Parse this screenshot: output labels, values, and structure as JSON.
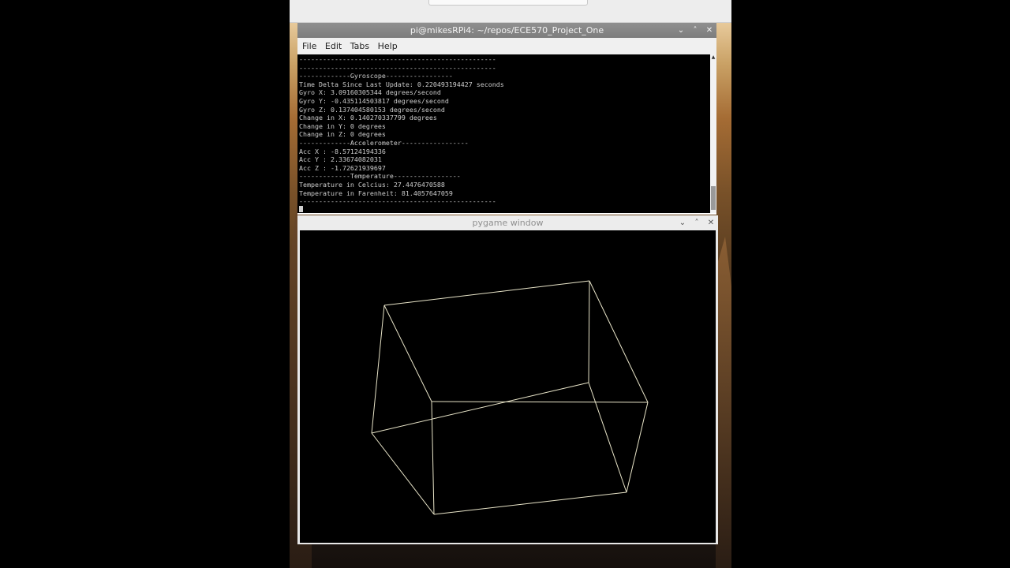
{
  "terminal": {
    "title": "pi@mikesRPi4: ~/repos/ECE570_Project_One",
    "menu": [
      "File",
      "Edit",
      "Tabs",
      "Help"
    ],
    "lines": [
      "--------------------------------------------------",
      "--------------------------------------------------",
      "-------------Gyroscope-----------------",
      "Time Delta Since Last Update: 0.220493194427 seconds",
      "Gyro X: 3.09160305344 degrees/second",
      "Gyro Y: -0.435114503817 degrees/second",
      "Gyro Z: 0.137404580153 degrees/second",
      "Change in X: 0.140270337799 degrees",
      "Change in Y: 0 degrees",
      "Change in Z: 0 degrees",
      "-------------Accelerometer-----------------",
      "Acc X : -8.57124194336",
      "Acc Y : 2.33674082031",
      "Acc Z : -1.72621939697",
      "-------------Temperature-----------------",
      "Temperature in Celcius: 27.4476470588",
      "Temperature in Farenheit: 81.4057647059",
      "--------------------------------------------------"
    ],
    "controls": {
      "minimize": "⌄",
      "maximize": "˄",
      "close": "✕"
    }
  },
  "pygame": {
    "title": "pygame window",
    "controls": {
      "minimize": "⌄",
      "maximize": "˄",
      "close": "✕"
    },
    "line_color": "#e8e4c8",
    "background": "#000000"
  }
}
